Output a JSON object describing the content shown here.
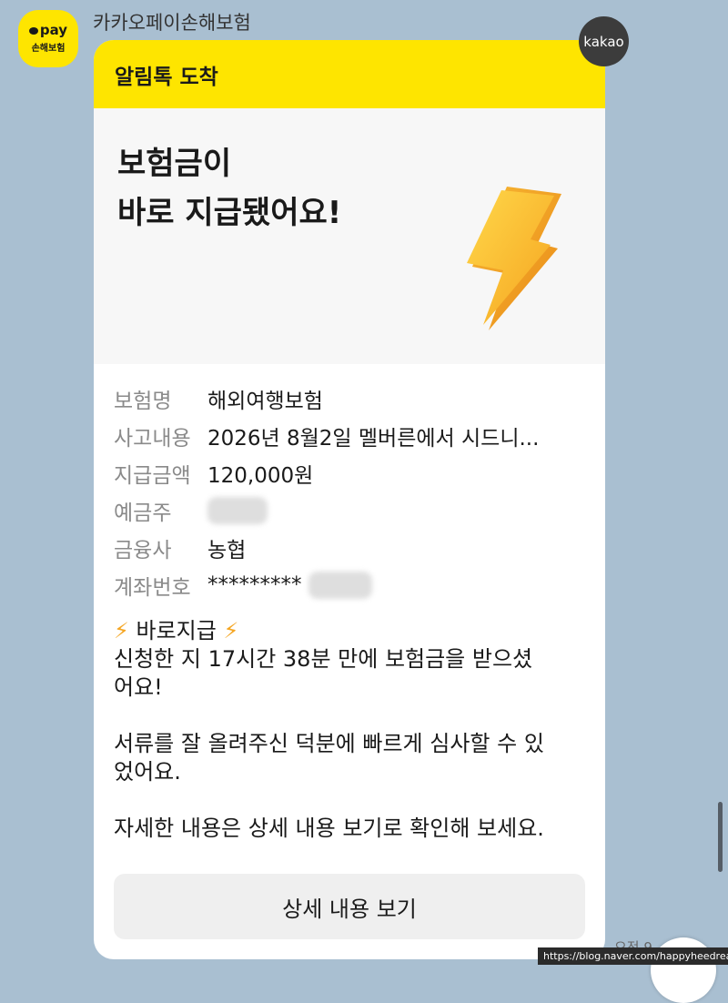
{
  "chat": {
    "sender_name": "카카오페이손해보험",
    "avatar": {
      "brand": "pay",
      "sub": "손해보험"
    },
    "badge": "kakao",
    "time": "오전 9"
  },
  "card": {
    "header": "알림톡 도착",
    "hero_line1": "보험금이",
    "hero_line2": "바로 지급됐어요!",
    "hero_icon": "lightning-icon",
    "details": {
      "product_label": "보험명",
      "product_value": "해외여행보험",
      "incident_label": "사고내용",
      "incident_value": "2026년 8월2일 멜버른에서 시드니...",
      "amount_label": "지급금액",
      "amount_value": "120,000원",
      "holder_label": "예금주",
      "bank_label": "금융사",
      "bank_value": "농협",
      "account_label": "계좌번호",
      "account_value": "*********"
    },
    "message": {
      "title": "바로지급",
      "line1": "신청한 지 17시간 38분 만에 보험금을 받으셨",
      "line2": "어요!",
      "line3": "서류를 잘 올려주신 덕분에 빠르게 심사할 수 있",
      "line4": "었어요.",
      "line5": "자세한 내용은 상세 내용 보기로 확인해 보세요."
    },
    "button": "상세 내용 보기"
  },
  "watermark": "https://blog.naver.com/happyheedream",
  "colors": {
    "background": "#a9bfd1",
    "kakao_yellow": "#fee500",
    "badge": "#3c3c3c"
  }
}
